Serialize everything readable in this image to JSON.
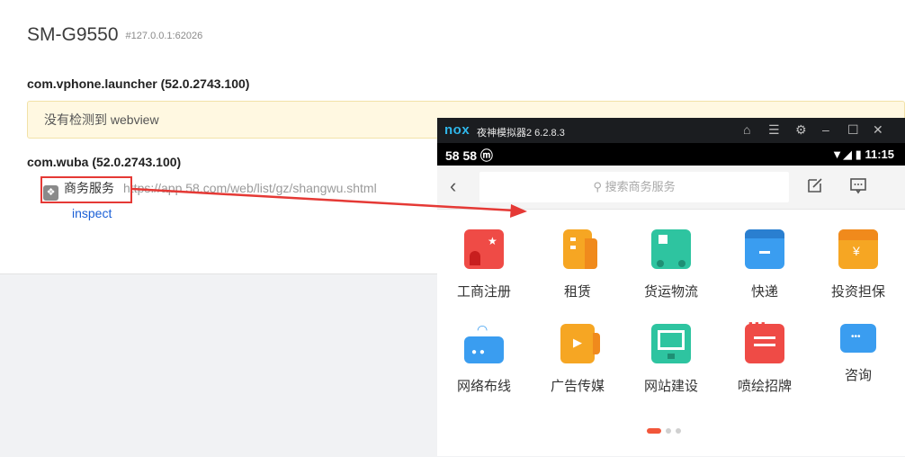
{
  "device": {
    "name": "SM-G9550",
    "address": "#127.0.0.1:62026"
  },
  "packages": [
    {
      "name": "com.vphone.launcher (52.0.2743.100)",
      "notice": "没有检测到 webview"
    },
    {
      "name": "com.wuba (52.0.2743.100)",
      "page": {
        "title": "商务服务",
        "url": "https://app.58.com/web/list/gz/shangwu.shtml",
        "inspect_label": "inspect"
      }
    }
  ],
  "emulator": {
    "brand": "nox",
    "title": "夜神模拟器2 6.2.8.3",
    "status": {
      "left": "58 58 ⓜ",
      "time": "11:15"
    },
    "search_placeholder": "搜索商务服务",
    "grid": [
      {
        "label": "工商注册",
        "icon": "business-registration-icon",
        "color": "#ef4b46"
      },
      {
        "label": "租赁",
        "icon": "lease-icon",
        "color": "#f6a623"
      },
      {
        "label": "货运物流",
        "icon": "truck-icon",
        "color": "#2ec4a0"
      },
      {
        "label": "快递",
        "icon": "express-box-icon",
        "color": "#3a9df0"
      },
      {
        "label": "投资担保",
        "icon": "investment-icon",
        "color": "#f6a623"
      },
      {
        "label": "网络布线",
        "icon": "router-icon",
        "color": "#3a9df0"
      },
      {
        "label": "广告传媒",
        "icon": "media-play-icon",
        "color": "#f6a623"
      },
      {
        "label": "网站建设",
        "icon": "monitor-icon",
        "color": "#2ec4a0"
      },
      {
        "label": "喷绘招牌",
        "icon": "signboard-icon",
        "color": "#ef4b46"
      },
      {
        "label": "咨询",
        "icon": "chat-icon",
        "color": "#3a9df0"
      }
    ],
    "page_indicator": {
      "pages": 3,
      "current": 1
    }
  },
  "colors": {
    "highlight": "#e53935",
    "link": "#1a5fd6",
    "notice_bg": "#fff8e1"
  }
}
